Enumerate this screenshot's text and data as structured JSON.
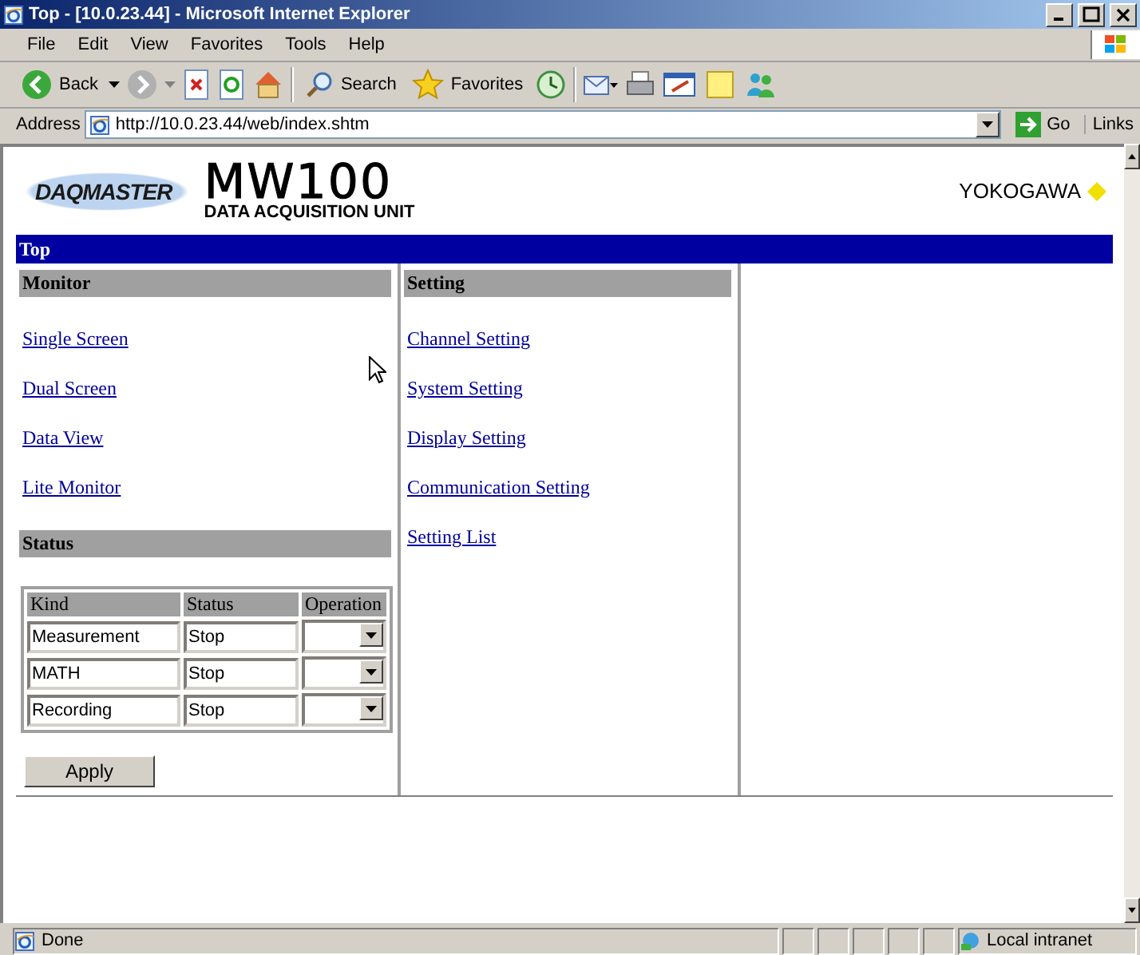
{
  "window": {
    "title": "Top - [10.0.23.44] - Microsoft Internet Explorer"
  },
  "menu": [
    "File",
    "Edit",
    "View",
    "Favorites",
    "Tools",
    "Help"
  ],
  "toolbar": {
    "back": "Back",
    "search": "Search",
    "favorites": "Favorites"
  },
  "address": {
    "label": "Address",
    "value": "http://10.0.23.44/web/index.shtm",
    "go": "Go",
    "links": "Links"
  },
  "page": {
    "logo": {
      "brand": "DAQMASTER",
      "model": "MW100",
      "subtitle": "DATA ACQUISITION UNIT",
      "maker": "YOKOGAWA"
    },
    "banner": "Top",
    "monitor": {
      "header": "Monitor",
      "links": [
        "Single Screen",
        "Dual Screen",
        "Data View",
        "Lite Monitor"
      ]
    },
    "status": {
      "header": "Status",
      "columns": [
        "Kind",
        "Status",
        "Operation"
      ],
      "rows": [
        {
          "kind": "Measurement",
          "status": "Stop"
        },
        {
          "kind": "MATH",
          "status": "Stop"
        },
        {
          "kind": "Recording",
          "status": "Stop"
        }
      ],
      "apply": "Apply"
    },
    "setting": {
      "header": "Setting",
      "links": [
        "Channel Setting",
        "System Setting",
        "Display Setting",
        "Communication Setting",
        "Setting List"
      ]
    }
  },
  "status_bar": {
    "text": "Done",
    "zone": "Local intranet"
  }
}
